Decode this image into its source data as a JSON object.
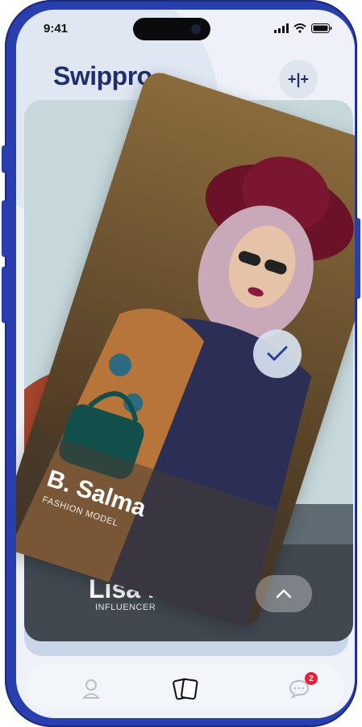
{
  "status_bar": {
    "time": "9:41"
  },
  "app": {
    "logo": "Swippro",
    "top_right_icon": "filter-icon",
    "top_right_label": "+|+"
  },
  "cards": [
    {
      "name": "B. Salma",
      "role": "FASHION MODEL",
      "position": "front"
    },
    {
      "name": "Lisa .A",
      "role": "INFLUENCER",
      "position": "back"
    }
  ],
  "overlays": {
    "check_icon": "check-icon",
    "up_icon": "chevron-up-icon"
  },
  "bottom_nav": {
    "items": [
      {
        "icon": "profile-icon"
      },
      {
        "icon": "cards-icon"
      },
      {
        "icon": "chat-icon",
        "badge": "2"
      }
    ]
  },
  "colors": {
    "brand": "#1f2f6b",
    "device_frame": "#2a3fae",
    "badge": "#e8213b"
  }
}
